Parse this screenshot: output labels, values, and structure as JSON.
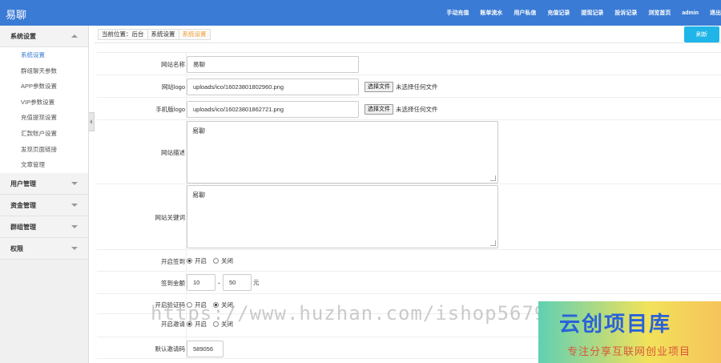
{
  "app": {
    "logo": "易聊"
  },
  "topnav": [
    "手动充值",
    "账单流水",
    "用户私信",
    "充值记录",
    "提现记录",
    "投诉记录",
    "浏览首页",
    "admin",
    "退出"
  ],
  "sidebar": {
    "groups": [
      {
        "label": "系统设置",
        "expanded": true,
        "items": [
          "系统设置",
          "群组聊天参数",
          "APP参数设置",
          "VIP参数设置",
          "充值提现设置",
          "汇款账户设置",
          "发现页面链接",
          "文章管理"
        ]
      },
      {
        "label": "用户管理"
      },
      {
        "label": "资金管理"
      },
      {
        "label": "群组管理"
      },
      {
        "label": "权限"
      }
    ]
  },
  "breadcrumb": [
    "当前位置：后台",
    "系统设置",
    "系统设置"
  ],
  "refresh_label": "刷新",
  "form": {
    "site_name": {
      "label": "网站名称",
      "value": "易聊"
    },
    "site_logo": {
      "label": "网站logo",
      "value": "uploads/ico/16023801802960.png",
      "button": "选择文件",
      "note": "未选择任何文件"
    },
    "mobile_logo": {
      "label": "手机版logo",
      "value": "uploads/ico/16023801862721.png",
      "button": "选择文件",
      "note": "未选择任何文件"
    },
    "site_desc": {
      "label": "网站描述",
      "value": "易聊"
    },
    "site_keywords": {
      "label": "网站关键词",
      "value": "易聊"
    },
    "signin": {
      "label": "开启签到",
      "on": "开启",
      "off": "关闭",
      "selected": "on"
    },
    "signin_amount": {
      "label": "签到金额",
      "min": "10",
      "dash": "-",
      "max": "50",
      "unit": "元"
    },
    "captcha": {
      "label": "开启验证码",
      "on": "开启",
      "off": "关闭",
      "selected": "off"
    },
    "invite": {
      "label": "开启邀请",
      "on": "开启",
      "off": "关闭",
      "selected": "on"
    },
    "default_invite": {
      "label": "默认邀请码",
      "value": "589056"
    }
  },
  "watermark": {
    "url": "https://www.huzhan.com/ishop5679",
    "banner_title": "云创项目库",
    "banner_subtitle": "专注分享互联网创业项目"
  },
  "colors": {
    "topbar": "#3a7bd5",
    "active_link": "#3a7bd5",
    "breadcrumb_current": "#f0a030",
    "refresh_button": "#1fb5e8"
  }
}
